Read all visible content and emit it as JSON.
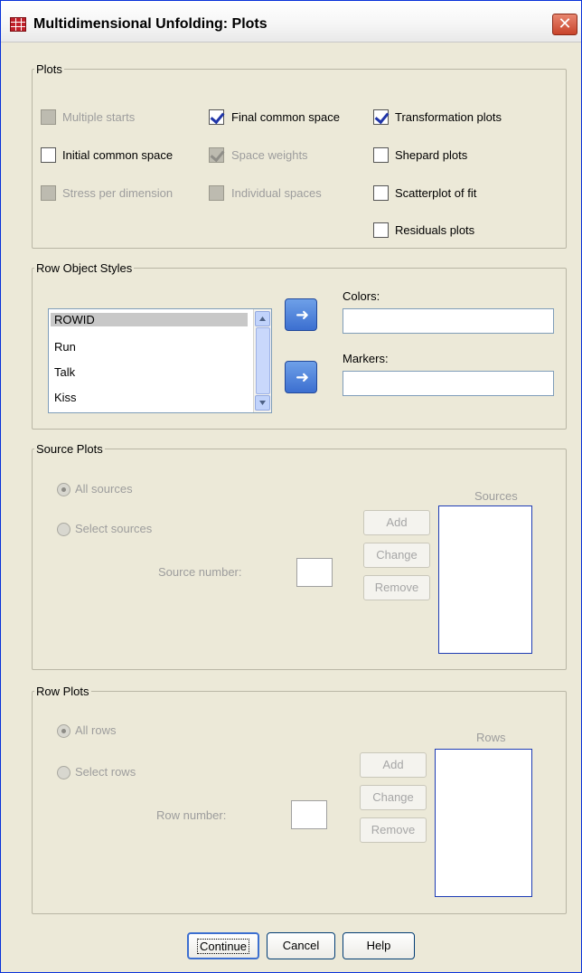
{
  "window": {
    "title": "Multidimensional Unfolding: Plots",
    "close_glyph": "✕"
  },
  "plots": {
    "legend": "Plots",
    "multiple_starts": "Multiple starts",
    "initial_common_space": "Initial common space",
    "stress_per_dimension": "Stress per dimension",
    "final_common_space": "Final common space",
    "space_weights": "Space weights",
    "individual_spaces": "Individual spaces",
    "transformation_plots": "Transformation plots",
    "shepard_plots": "Shepard plots",
    "scatterplot_of_fit": "Scatterplot of fit",
    "residuals_plots": "Residuals plots"
  },
  "row_object_styles": {
    "legend": "Row Object Styles",
    "items": [
      "ROWID",
      "Run",
      "Talk",
      "Kiss"
    ],
    "colors_label": "Colors:",
    "markers_label": "Markers:",
    "colors_value": "",
    "markers_value": ""
  },
  "source_plots": {
    "legend": "Source Plots",
    "all_sources": "All sources",
    "select_sources": "Select sources",
    "source_number": "Source number:",
    "sources_label": "Sources",
    "add": "Add",
    "change": "Change",
    "remove": "Remove"
  },
  "row_plots": {
    "legend": "Row Plots",
    "all_rows": "All rows",
    "select_rows": "Select rows",
    "row_number": "Row number:",
    "rows_label": "Rows",
    "add": "Add",
    "change": "Change",
    "remove": "Remove"
  },
  "buttons": {
    "continue": "Continue",
    "cancel": "Cancel",
    "help": "Help"
  },
  "colors": {
    "accent": "#0831d9",
    "checkmark": "#2035a8",
    "disabled_text": "#9d9d9d"
  }
}
